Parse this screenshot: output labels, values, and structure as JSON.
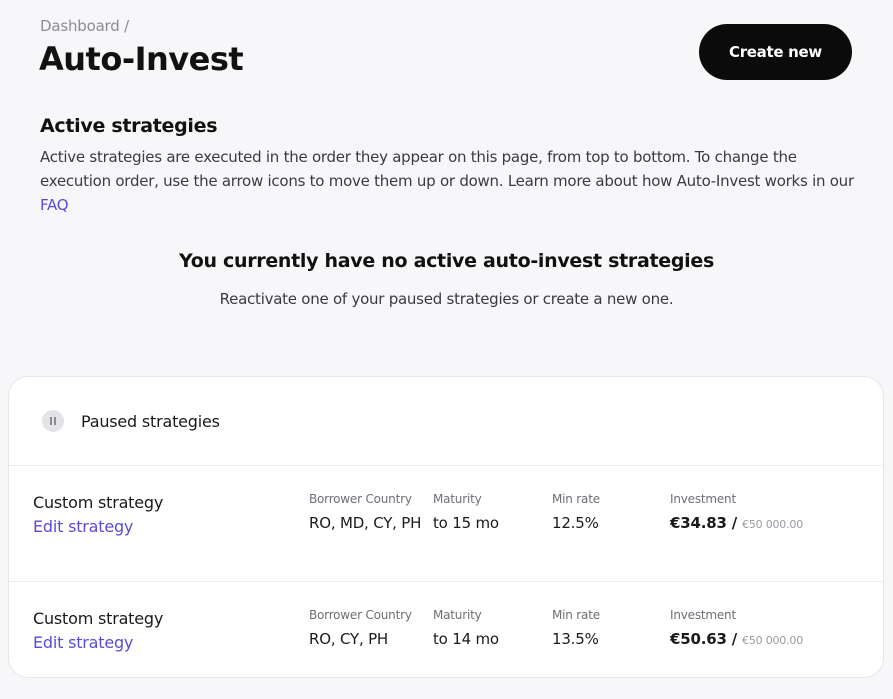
{
  "header": {
    "breadcrumb": "Dashboard /",
    "title": "Auto-Invest",
    "create_label": "Create new"
  },
  "active": {
    "heading": "Active strategies",
    "description": "Active strategies are executed in the order they appear on this page, from top to bottom. To change the execution order, use the arrow icons to move them up or down. Learn more about how Auto-Invest works in our ",
    "faq_link": "FAQ",
    "empty_title": "You currently have no active auto-invest strategies",
    "empty_subtitle": "Reactivate one of your paused strategies or create a new one."
  },
  "paused": {
    "title": "Paused strategies",
    "icon": "pause-icon",
    "columns": {
      "country": "Borrower Country",
      "maturity": "Maturity",
      "min_rate": "Min rate",
      "investment": "Investment"
    },
    "strategies": [
      {
        "name": "Custom strategy",
        "edit_label": "Edit strategy",
        "country": "RO, MD, CY, PH",
        "maturity": "to 15 mo",
        "min_rate": "12.5%",
        "investment": "€34.83",
        "separator": " / ",
        "limit": "€50 000.00"
      },
      {
        "name": "Custom strategy",
        "edit_label": "Edit strategy",
        "country": "RO, CY, PH",
        "maturity": "to 14 mo",
        "min_rate": "13.5%",
        "investment": "€50.63",
        "separator": " / ",
        "limit": "€50 000.00"
      }
    ]
  },
  "colors": {
    "background": "#f7f7f9",
    "accent_link": "#5b4bd6",
    "button_bg": "#0b0b0b"
  }
}
